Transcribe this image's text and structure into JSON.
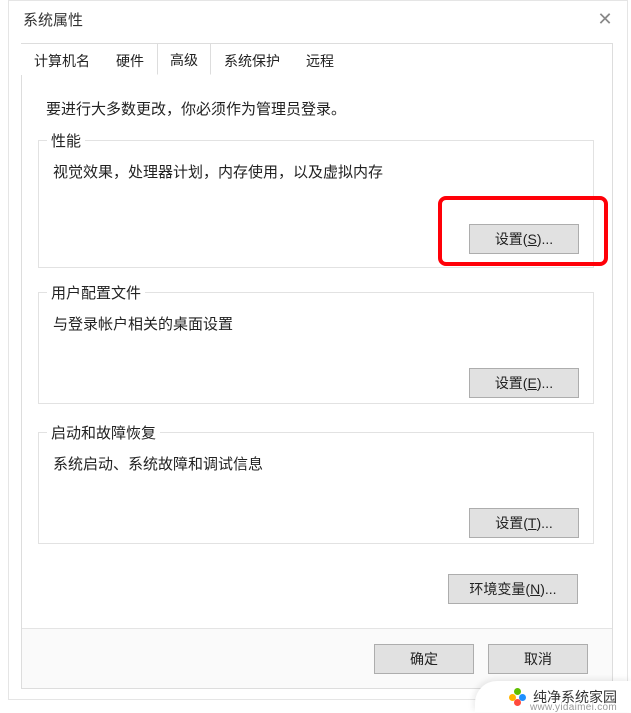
{
  "window": {
    "title": "系统属性",
    "close": "✕"
  },
  "tabs": {
    "items": [
      "计算机名",
      "硬件",
      "高级",
      "系统保护",
      "远程"
    ],
    "selected": 2
  },
  "admin_note": "要进行大多数更改，你必须作为管理员登录。",
  "groups": {
    "perf": {
      "legend": "性能",
      "desc": "视觉效果，处理器计划，内存使用，以及虚拟内存",
      "button": "设置(S)...",
      "accesskey": "S"
    },
    "profiles": {
      "legend": "用户配置文件",
      "desc": "与登录帐户相关的桌面设置",
      "button": "设置(E)...",
      "accesskey": "E"
    },
    "startup": {
      "legend": "启动和故障恢复",
      "desc": "系统启动、系统故障和调试信息",
      "button": "设置(T)...",
      "accesskey": "T"
    }
  },
  "env_button": "环境变量(N)...",
  "env_accesskey": "N",
  "footer": {
    "ok": "确定",
    "cancel": "取消"
  },
  "watermark": {
    "name": "纯净系统家园",
    "url": "www.yidaimei.com"
  }
}
